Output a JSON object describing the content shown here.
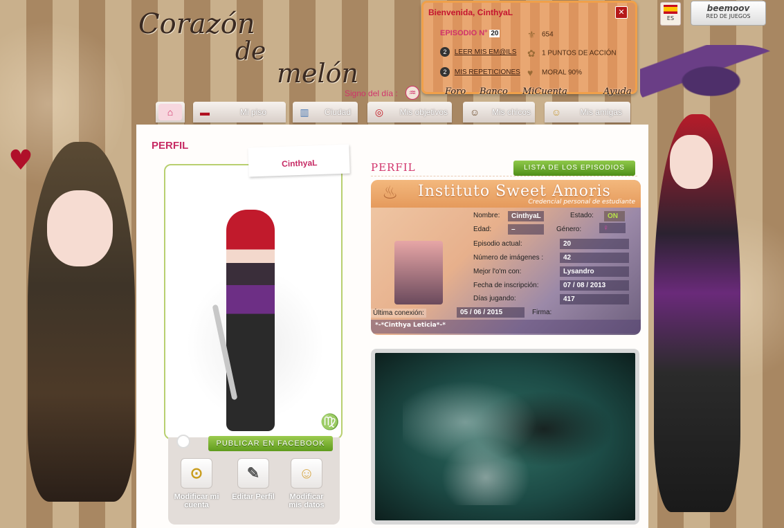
{
  "site": {
    "logo_line1": "Corazón",
    "logo_line2": "de",
    "logo_line3": "melón",
    "sign_label": "Signo del día :",
    "sign_symbol": "♒"
  },
  "user_panel": {
    "welcome": "Bienvenida, CinthyaL",
    "close_symbol": "✕",
    "episode_label": "EPISODIO N°",
    "episode_number": "20",
    "emails_count": "2",
    "emails_link": "LEER MIS EM@ILS",
    "repeats_count": "2",
    "repeats_link": "MIS REPETICIONES",
    "dollars": "654",
    "action_points": "1 PUNTOS DE ACCIÓN",
    "moral": "MORAL 90%"
  },
  "top_links": [
    "Foro",
    "Banco",
    "MiCuenta",
    "Ayuda"
  ],
  "language": {
    "code": "ES"
  },
  "beemoov": {
    "name": "beemoov",
    "tagline": "RED DE JUEGOS"
  },
  "nav": {
    "items": [
      {
        "label": "",
        "icon": "home-icon",
        "glyph": "⌂"
      },
      {
        "label": "Mi piso",
        "icon": "sofa-icon",
        "glyph": "▬"
      },
      {
        "label": "Ciudad",
        "icon": "building-icon",
        "glyph": "▥"
      },
      {
        "label": "Mis objetivos",
        "icon": "target-icon",
        "glyph": "◎"
      },
      {
        "label": "Mis chicos",
        "icon": "boy-avatar-icon",
        "glyph": "☺"
      },
      {
        "label": "Mis amigas",
        "icon": "girl-avatar-icon",
        "glyph": "☺"
      }
    ]
  },
  "profile": {
    "page_title": "PERFIL",
    "name_tab": "CinthyaL",
    "zodiac_symbol": "♍",
    "publish_button": "PUBLICAR EN FACEBOOK",
    "actions": [
      {
        "label": "Modificar mi cuenta",
        "icon": "padlock-icon",
        "glyph": "🔒"
      },
      {
        "label": "Editar Perfil",
        "icon": "pen-icon",
        "glyph": "✎"
      },
      {
        "label": "Modificar mis datos",
        "icon": "avatar-icon",
        "glyph": "☺"
      }
    ]
  },
  "right": {
    "heading": "PERFIL",
    "episodes_button": "LISTA DE LOS EPISODIOS"
  },
  "id_card": {
    "title": "Instituto Sweet Amoris",
    "subtitle": "Credencial personal de estudiante",
    "name_label": "Nombre:",
    "name_value": "CinthyaL",
    "state_label": "Estado:",
    "state_value": "ON",
    "age_label": "Edad:",
    "age_value": "–",
    "gender_label": "Género:",
    "gender_symbol": "♀",
    "episode_label": "Episodio actual:",
    "episode_value": "20",
    "images_label": "Número de imágenes :",
    "images_value": "42",
    "best_label": "Mejor l'o'm con:",
    "best_value": "Lysandro",
    "signup_label": "Fecha de inscripción:",
    "signup_value": "07 / 08 / 2013",
    "days_label": "Días jugando:",
    "days_value": "417",
    "last_label": "Última conexión:",
    "last_value": "05 / 06 / 2015",
    "signature_label": "Firma:",
    "signature_value": "*-*Cinthya Leticia*-*"
  },
  "colors": {
    "accent": "#c62a64",
    "green": "#6aa52a",
    "panel_border": "#f0a04a"
  }
}
